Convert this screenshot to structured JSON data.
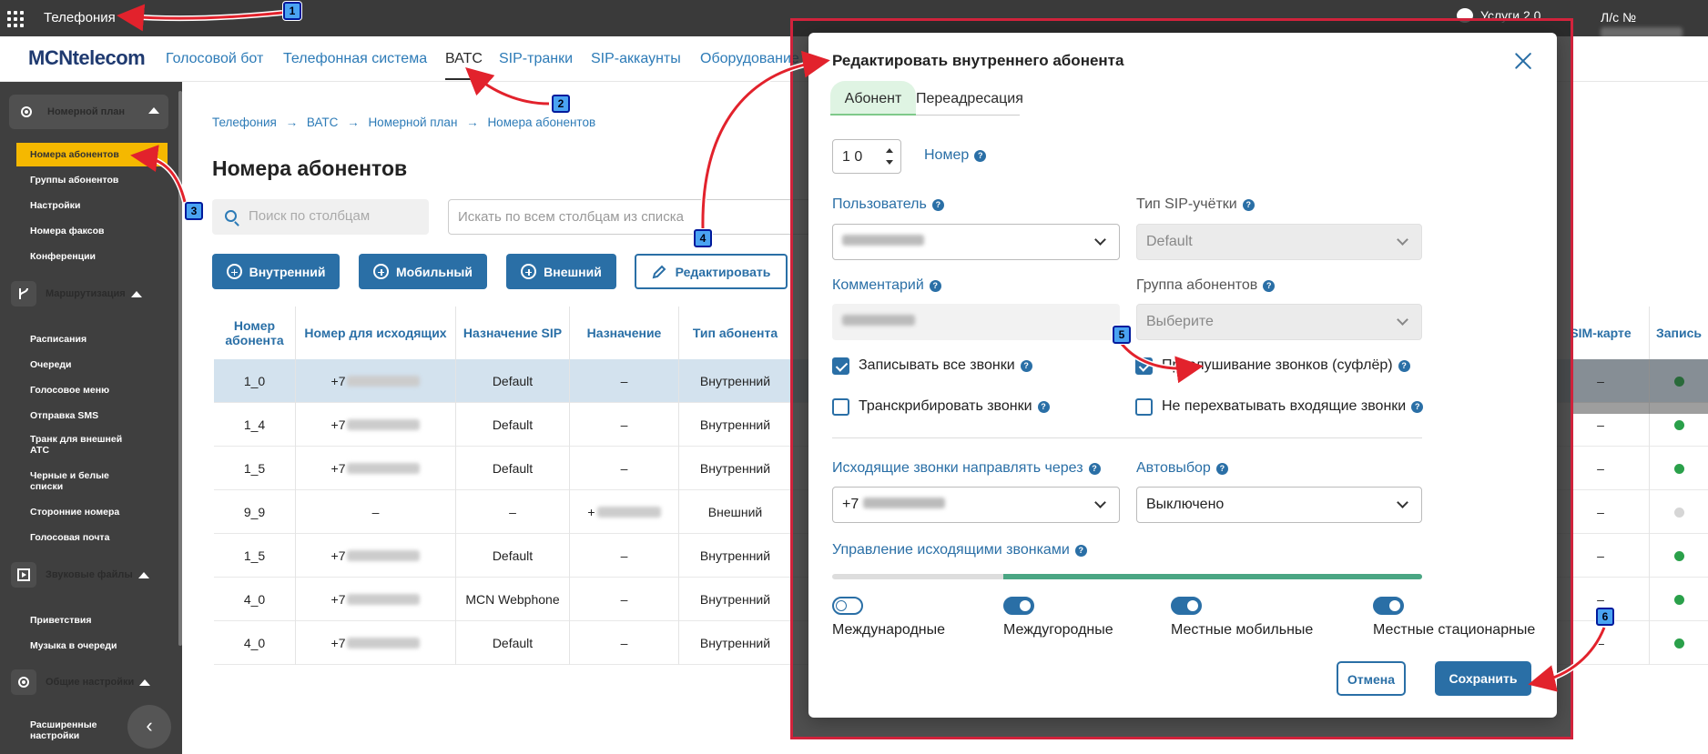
{
  "topbar": {
    "title": "Телефония",
    "services": "Услуги 2.0",
    "account": "Л/с №"
  },
  "nav": {
    "logo": "MCNtelecom",
    "items": [
      "Голосовой бот",
      "Телефонная система",
      "ВАТС",
      "SIP-транки",
      "SIP-аккаунты",
      "Оборудование"
    ],
    "active": "ВАТС"
  },
  "sidebar": {
    "group1": "Номерной план",
    "group1_items": [
      "Номера абонентов",
      "Группы абонентов",
      "Настройки",
      "Номера факсов",
      "Конференции"
    ],
    "group2": "Маршрутизация",
    "group2_items": [
      "Расписания",
      "Очереди",
      "Голосовое меню",
      "Отправка SMS",
      "Транк для внешней АТС",
      "Черные и белые списки",
      "Сторонние номера",
      "Голосовая почта"
    ],
    "group3": "Звуковые файлы",
    "group3_items": [
      "Приветствия",
      "Музыка в очереди"
    ],
    "group4": "Общие настройки",
    "group4_items": [
      "Расширенные настройки"
    ]
  },
  "main": {
    "breadcrumb": [
      "Телефония",
      "ВАТС",
      "Номерной план",
      "Номера абонентов"
    ],
    "title": "Номера абонентов",
    "search_placeholder": "Поиск по столбцам",
    "search_all_placeholder": "Искать по всем столбцам из списка",
    "buttons": {
      "internal": "Внутренний",
      "mobile": "Мобильный",
      "external": "Внешний",
      "edit": "Редактировать"
    }
  },
  "table": {
    "headers": {
      "number": "Номер абонента",
      "outgoing": "Номер для исходящих",
      "sip_dest": "Назначение SIP",
      "dest": "Назначение",
      "type": "Тип абонента",
      "sim": "SIM-карте",
      "rec": "Запись"
    },
    "rows": [
      {
        "number": "1_0",
        "outgoing": "+7",
        "sip": "Default",
        "dest": "–",
        "type": "Внутренний",
        "sim": "–",
        "rec": true
      },
      {
        "number": "1_4",
        "outgoing": "+7",
        "sip": "Default",
        "dest": "–",
        "type": "Внутренний",
        "sim": "–",
        "rec": true
      },
      {
        "number": "1_5",
        "outgoing": "+7",
        "sip": "Default",
        "dest": "–",
        "type": "Внутренний",
        "sim": "–",
        "rec": true
      },
      {
        "number": "9_9",
        "outgoing": "–",
        "sip": "–",
        "dest": "+",
        "type": "Внешний",
        "sim": "–",
        "rec": false
      },
      {
        "number": "1_5",
        "outgoing": "+7",
        "sip": "Default",
        "dest": "–",
        "type": "Внутренний",
        "sim": "–",
        "rec": true
      },
      {
        "number": "4_0",
        "outgoing": "+7",
        "sip": "MCN Webphone",
        "dest": "–",
        "type": "Внутренний",
        "sim": "–",
        "rec": true
      },
      {
        "number": "4_0",
        "outgoing": "+7",
        "sip": "Default",
        "dest": "–",
        "type": "Внутренний",
        "sim": "–",
        "rec": true
      }
    ]
  },
  "modal": {
    "title": "Редактировать внутреннего абонента",
    "tabs": [
      "Абонент",
      "Переадресация"
    ],
    "number_value": "1 0",
    "number_label": "Номер",
    "user_label": "Пользователь",
    "user_value": "",
    "sip_type_label": "Тип SIP-учётки",
    "sip_type_value": "Default",
    "comment_label": "Комментарий",
    "comment_value": "",
    "group_label": "Группа абонентов",
    "group_value": "Выберите",
    "cb_record": "Записывать все звонки",
    "cb_listen": "Прослушивание звонков (суфлёр)",
    "cb_transcribe": "Транскрибировать звонки",
    "cb_no_intercept": "Не перехватывать входящие звонки",
    "outgoing_label": "Исходящие звонки направлять через",
    "outgoing_value": "+7",
    "autoselect_label": "Автовыбор",
    "autoselect_value": "Выключено",
    "control_label": "Управление исходящими звонками",
    "toggles": [
      "Международные",
      "Междугородные",
      "Местные мобильные",
      "Местные стационарные"
    ],
    "cancel": "Отмена",
    "save": "Сохранить"
  },
  "annotations": [
    "1",
    "2",
    "3",
    "4",
    "5",
    "6"
  ]
}
